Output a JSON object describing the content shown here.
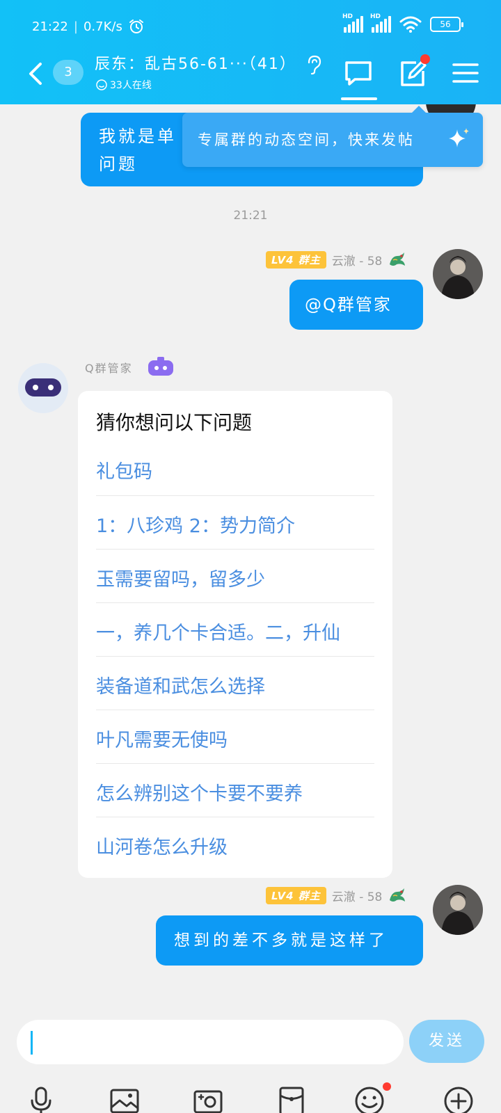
{
  "status": {
    "time": "21:22",
    "speed": "0.7K/s",
    "hd1": "HD",
    "hd2": "HD",
    "battery": "56"
  },
  "header": {
    "unread_count": "3",
    "group_title": "辰东：乱古56-61···（41）",
    "online": "33人在线"
  },
  "tooltip": {
    "text": "专属群的动态空间，快来发帖"
  },
  "messages": {
    "partial_line1": "我就是单",
    "partial_line2": "问题",
    "time": "21:21",
    "sender_level": "LV4",
    "sender_role": "群主",
    "sender_name": "云澈 - 58",
    "mention_text": "@Q群管家",
    "bot_name": "Q群管家",
    "bot_heading": "猜你想问以下问题",
    "bot_options": [
      "礼包码",
      "1：八珍鸡 2：势力简介",
      "玉需要留吗，留多少",
      "一，养几个卡合适。二，升仙",
      "装备道和武怎么选择",
      "叶凡需要无使吗",
      "怎么辨别这个卡要不要养",
      "山河卷怎么升级"
    ],
    "last_text": "想到的差不多就是这样了"
  },
  "input": {
    "value": "",
    "send_label": "发送"
  },
  "toolbar_icons": [
    "mic-icon",
    "image-icon",
    "camera-icon",
    "red-packet-icon",
    "emoji-icon",
    "plus-icon"
  ],
  "colors": {
    "header": "#12c1f7",
    "bubble": "#0d9af5",
    "link": "#4a8ee0",
    "level_badge": "#fdc33a",
    "badge_dot": "#ff3b30"
  }
}
